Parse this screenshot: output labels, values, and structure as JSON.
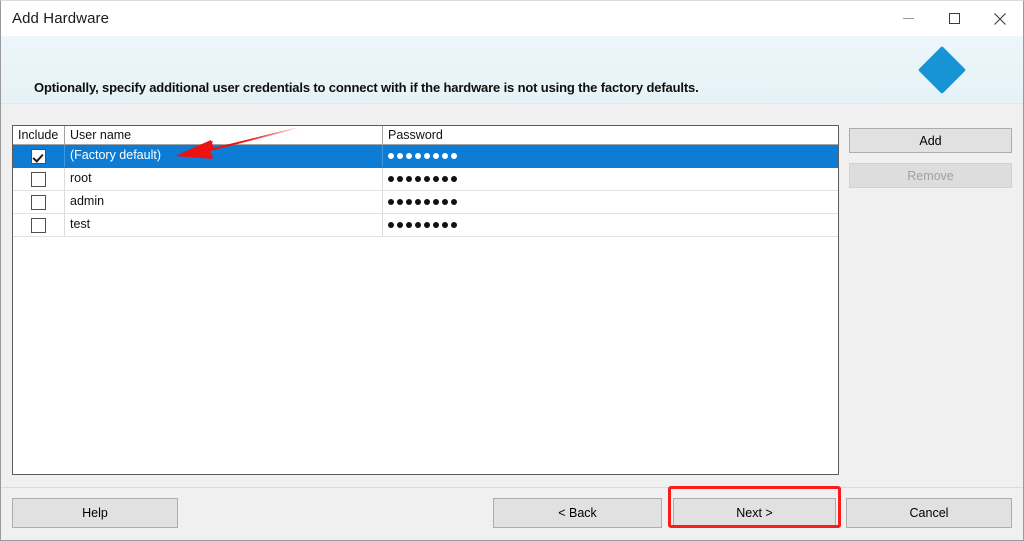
{
  "window": {
    "title": "Add Hardware",
    "caption_buttons": [
      {
        "name": "minimize",
        "label": "—"
      },
      {
        "name": "maximize",
        "label": "□"
      },
      {
        "name": "close",
        "label": "✕"
      }
    ]
  },
  "banner": {
    "text": "Optionally, specify additional user credentials to connect with if the hardware is not using the factory defaults.",
    "logo_icon": "blue-diamond-logo",
    "logo_color": "#1794d4",
    "background_color": "#eaf5f9"
  },
  "grid": {
    "columns": [
      "Include",
      "User name",
      "Password"
    ],
    "rows": [
      {
        "include": true,
        "user_name": "(Factory default)",
        "password_masked": "●●●●●●●●",
        "password_dots": 8,
        "selected": true
      },
      {
        "include": false,
        "user_name": "root",
        "password_masked": "●●●●●●●●",
        "password_dots": 8,
        "selected": false
      },
      {
        "include": false,
        "user_name": "admin",
        "password_masked": "●●●●●●●●",
        "password_dots": 8,
        "selected": false
      },
      {
        "include": false,
        "user_name": "test",
        "password_masked": "●●●●●●●●",
        "password_dots": 8,
        "selected": false
      }
    ],
    "selection_color": "#0c7cd5"
  },
  "side_buttons": {
    "add_label": "Add",
    "remove_label": "Remove",
    "remove_disabled": true
  },
  "footer": {
    "help_label": "Help",
    "back_label": "< Back",
    "next_label": "Next >",
    "cancel_label": "Cancel"
  },
  "annotations": {
    "arrow_color": "#ee1111",
    "highlight_color": "#fb1c1c",
    "arrow_target": "(Factory default) row",
    "highlight_target": "Next > button"
  }
}
